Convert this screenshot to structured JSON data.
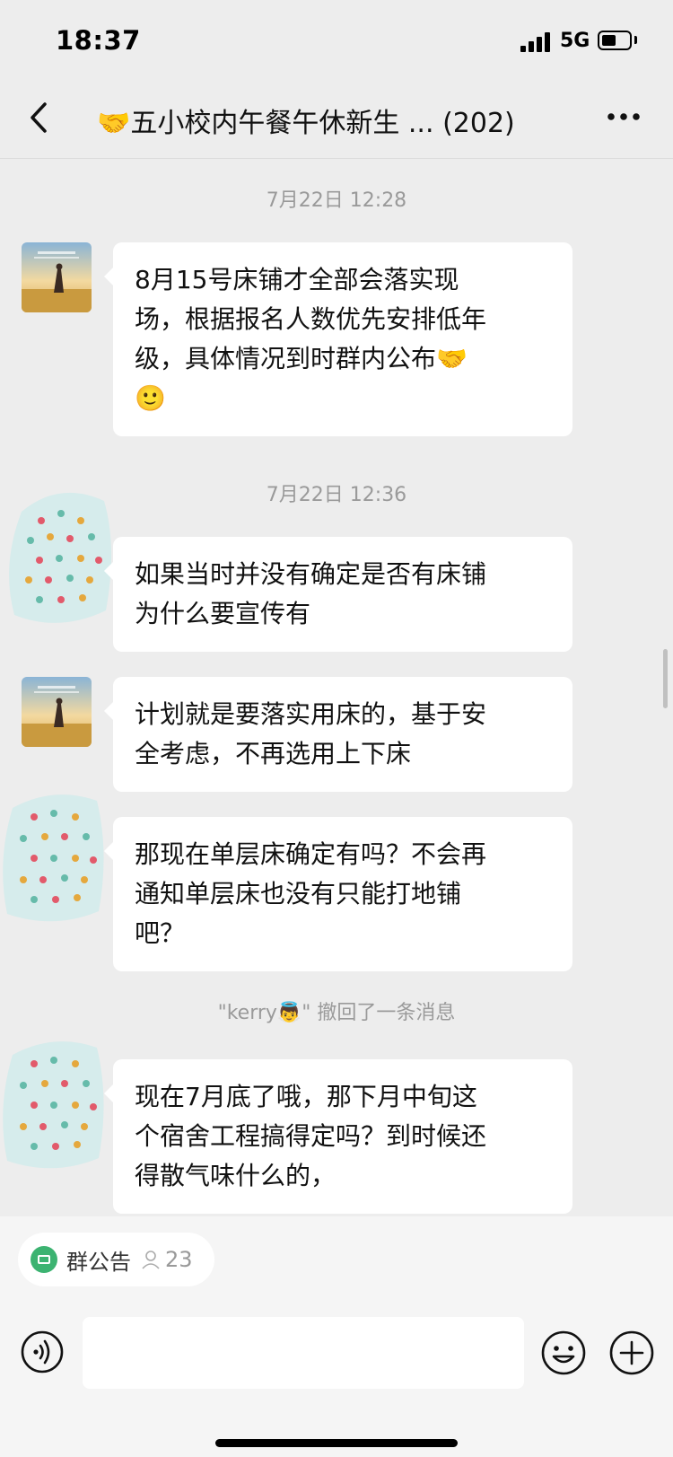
{
  "status_bar": {
    "time": "18:37",
    "network": "5G",
    "battery_level": 0.55
  },
  "header": {
    "title_emoji": "🤝",
    "title": "五小校内午餐午休新生 ...",
    "member_count": "(202)",
    "back_icon": "chevron-left-icon",
    "more_icon": "more-dots-icon"
  },
  "messages": [
    {
      "type": "time",
      "text": "7月22日 12:28"
    },
    {
      "type": "text",
      "sender_avatar": "photo-avatar",
      "lines": [
        "8月15号床铺才全部会落实现",
        "场，根据报名人数优先安排低年",
        "级，具体情况到时群内公布🤝",
        "🙂"
      ]
    },
    {
      "type": "time",
      "text": "7月22日 12:36"
    },
    {
      "type": "text",
      "sender_avatar": "polka-dot-avatar",
      "lines": [
        "如果当时并没有确定是否有床铺",
        "为什么要宣传有"
      ]
    },
    {
      "type": "text",
      "sender_avatar": "photo-avatar",
      "lines": [
        "计划就是要落实用床的，基于安",
        "全考虑，不再选用上下床"
      ]
    },
    {
      "type": "text",
      "sender_avatar": "polka-dot-avatar",
      "lines": [
        "那现在单层床确定有吗？不会再",
        "通知单层床也没有只能打地铺",
        "吧？"
      ]
    },
    {
      "type": "system",
      "text": "\"kerry👼\" 撤回了一条消息"
    },
    {
      "type": "text",
      "sender_avatar": "polka-dot-avatar",
      "lines": [
        "现在7月底了哦，那下月中旬这",
        "个宿舍工程搞得定吗？到时候还",
        "得散气味什么的，"
      ]
    }
  ],
  "bottom_bar": {
    "notice_label": "群公告",
    "notice_count": "23",
    "input_value": ""
  },
  "colors": {
    "background": "#ededed",
    "bubble": "#ffffff",
    "notice_green": "#3cb371"
  }
}
